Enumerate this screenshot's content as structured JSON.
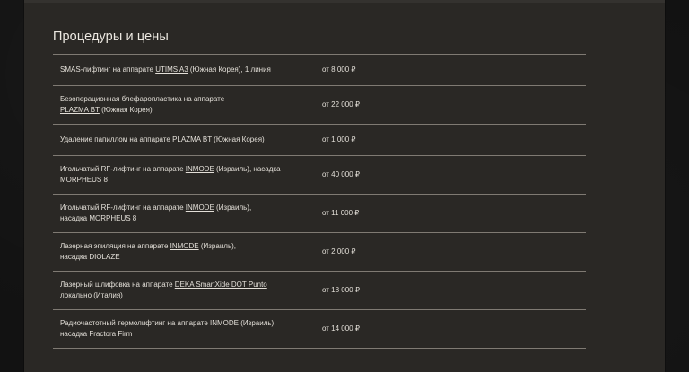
{
  "page": {
    "title": "Процедуры и цены"
  },
  "items": [
    {
      "lines": [
        [
          {
            "text": "SMAS-лифтинг на аппарате "
          },
          {
            "text": "UTIMS A3",
            "underline": true
          },
          {
            "text": " (Южная Корея), 1 линия"
          }
        ]
      ],
      "price": "от 8 000 ₽"
    },
    {
      "lines": [
        [
          {
            "text": "Безоперационная блефаропластика на аппарате"
          }
        ],
        [
          {
            "text": "PLAZMA BT",
            "underline": true
          },
          {
            "text": " (Южная Корея)"
          }
        ]
      ],
      "price": "от 22 000 ₽"
    },
    {
      "lines": [
        [
          {
            "text": "Удаление папиллом на аппарате "
          },
          {
            "text": "PLAZMA BT",
            "underline": true
          },
          {
            "text": " (Южная Корея)"
          }
        ]
      ],
      "price": "от 1 000 ₽"
    },
    {
      "lines": [
        [
          {
            "text": "Игольчатый RF-лифтинг на аппарате "
          },
          {
            "text": "INMODE",
            "underline": true
          },
          {
            "text": " (Израиль), насадка"
          }
        ],
        [
          {
            "text": "MORPHEUS 8"
          }
        ]
      ],
      "price": "от 40 000 ₽"
    },
    {
      "lines": [
        [
          {
            "text": "Игольчатый RF-лифтинг на аппарате "
          },
          {
            "text": "INMODE",
            "underline": true
          },
          {
            "text": " (Израиль),"
          }
        ],
        [
          {
            "text": "насадка MORPHEUS 8"
          }
        ]
      ],
      "price": "от 11 000 ₽"
    },
    {
      "lines": [
        [
          {
            "text": "Лазерная эпиляция на аппарате "
          },
          {
            "text": "INMODE",
            "underline": true
          },
          {
            "text": " (Израиль),"
          }
        ],
        [
          {
            "text": "насадка DIOLAZE"
          }
        ]
      ],
      "price": "от 2 000 ₽"
    },
    {
      "lines": [
        [
          {
            "text": "Лазерный шлифовка на аппарате "
          },
          {
            "text": "DEKA SmartXide DOT Punto",
            "underline": true
          }
        ],
        [
          {
            "text": "локально (Италия)"
          }
        ]
      ],
      "price": "от 18 000 ₽"
    },
    {
      "lines": [
        [
          {
            "text": "Радиочастотный термолифтинг на аппарате INMODE (Израиль),"
          }
        ],
        [
          {
            "text": "насадка Fractora Firm"
          }
        ]
      ],
      "price": "от 14 000 ₽"
    }
  ]
}
